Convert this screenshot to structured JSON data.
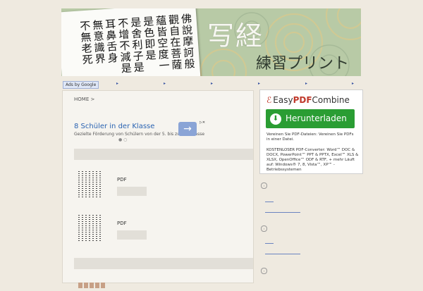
{
  "banner": {
    "title": "写経",
    "subtitle": "練習プリント",
    "sutra_columns": [
      "佛說摩訶般",
      "觀自在菩薩",
      "蘊皆空度一",
      "是色即是",
      "是舍利子是",
      "不增不減是",
      "耳鼻舌身",
      "無意識界",
      "不無老死"
    ]
  },
  "linkbar": {
    "ads_label": "Ads by Google",
    "links": [
      "▸",
      "▸",
      "▸",
      "▸",
      "▸",
      "▸"
    ]
  },
  "main": {
    "breadcrumb": "HOME >",
    "ad": {
      "title": "8 Schüler in der Klasse",
      "description": "Gezielte Förderung von Schülern von der 5. bis zur 13. Klasse",
      "arrow": "→",
      "pager": "● ○"
    },
    "items": [
      {
        "label": "PDF"
      },
      {
        "label": "PDF"
      }
    ]
  },
  "sidebar_ad": {
    "logo_prefix": "Easy",
    "logo_pdf": "PDF",
    "logo_suffix": "Combine",
    "download_label": "Herunterladen",
    "text1": "Vereinen Sie PDF-Dateien: Vereinen Sie PDFs in einer Datei.",
    "text2": "KOSTENLOSER PDF-Converter: Word™ DOC & DOCX, PowerPoint™ PPT & PPTX, Excel™ XLS & XLSX, OpenOffice™ ODF & RTF, + mehr Läuft auf: Windows® 7, 8, Vista™, XP™ -Betriebssystemen"
  },
  "colors": {
    "background": "#efeae0",
    "banner_green": "#b7c9a6",
    "link_blue": "#3955a3",
    "download_green": "#2a9d33",
    "pdf_red": "#c0392b"
  }
}
